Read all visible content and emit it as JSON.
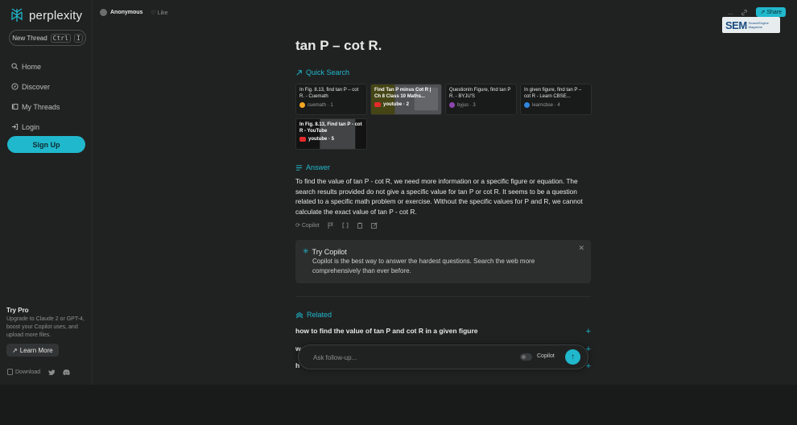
{
  "sidebar": {
    "logo_text": "perplexity",
    "new_thread": "New Thread",
    "shortcut_key": "Ctrl",
    "shortcut_key2": "I",
    "nav": [
      {
        "label": "Home",
        "icon": "search-icon"
      },
      {
        "label": "Discover",
        "icon": "compass-icon"
      },
      {
        "label": "My Threads",
        "icon": "library-icon"
      },
      {
        "label": "Login",
        "icon": "login-icon"
      }
    ],
    "signup": "Sign Up",
    "try_pro": {
      "title": "Try Pro",
      "text": "Upgrade to Claude 2 or GPT-4, boost your Copilot uses, and upload more files.",
      "button": "Learn More"
    },
    "download": "Download"
  },
  "topbar": {
    "author": "Anonymous",
    "like": "Like",
    "more": "...",
    "share": "Share"
  },
  "watermark": {
    "big": "SEM",
    "small_1": "SearchEngine",
    "small_2": "Magazine"
  },
  "main": {
    "title": "tan P – cot R.",
    "quick_search": "Quick Search",
    "sources": [
      {
        "title": "In Fig. 8.13, find tan P – cot R. - Cuemath",
        "source": "cuemath · 1",
        "color": "#f5a623",
        "image": false
      },
      {
        "title": "Find Tan P minus Cot R | Ch 8 Class 10 Maths...",
        "source": "youtube · 2",
        "color": "#e32b2b",
        "image": true
      },
      {
        "title": "QuestionIn Figure, find tan P R. - BYJU'S",
        "source": "byjus · 3",
        "color": "#8e44ad",
        "image": false
      },
      {
        "title": "In given figure, find tan P – cot R - Learn CBSE...",
        "source": "learncbse · 4",
        "color": "#2e86de",
        "image": false
      },
      {
        "title": "In Fig. 8.13, Find tan P - cot R - YouTube",
        "source": "youtube · 5",
        "color": "#e32b2b",
        "image": true
      }
    ],
    "answer_label": "Answer",
    "answer": "To find the value of tan P - cot R, we need more information or a specific figure or equation. The search results provided do not give a specific value for tan P or cot R. It seems to be a question related to a specific math problem or exercise. Without the specific values for P and R, we cannot calculate the exact value of tan P - cot R.",
    "copilot_tool": "Copilot",
    "copilot_box": {
      "title": "Try Copilot",
      "desc": "Copilot is the best way to answer the hardest questions. Search the web more comprehensively than ever before."
    },
    "related_label": "Related",
    "related": [
      "how to find the value of tan P and cot R in a given figure",
      "w",
      "h"
    ]
  },
  "followup": {
    "placeholder": "Ask follow-up...",
    "copilot": "Copilot"
  },
  "colors": {
    "accent": "#20b8cd",
    "background": "#202222"
  }
}
